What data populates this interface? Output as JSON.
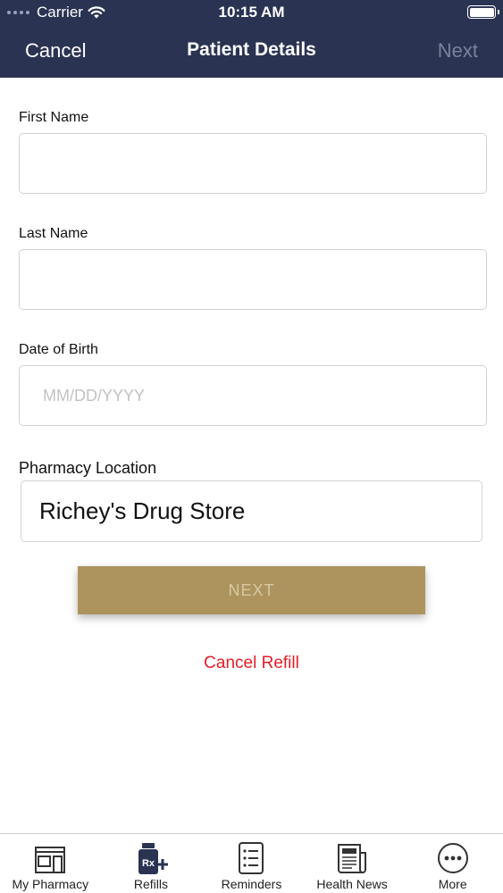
{
  "status_bar": {
    "carrier": "Carrier",
    "time": "10:15 AM"
  },
  "nav": {
    "cancel_label": "Cancel",
    "title": "Patient Details",
    "next_label": "Next"
  },
  "form": {
    "first_name": {
      "label": "First Name",
      "value": "",
      "placeholder": ""
    },
    "last_name": {
      "label": "Last Name",
      "value": "",
      "placeholder": ""
    },
    "dob": {
      "label": "Date of Birth",
      "value": "",
      "placeholder": "MM/DD/YYYY"
    },
    "pharmacy": {
      "label": "Pharmacy Location",
      "value": "Richey's Drug Store"
    }
  },
  "next_button_label": "NEXT",
  "cancel_refill_label": "Cancel Refill",
  "tabs": [
    {
      "label": "My Pharmacy",
      "icon": "storefront-icon"
    },
    {
      "label": "Refills",
      "icon": "rx-bottle-icon",
      "badge": "Rx"
    },
    {
      "label": "Reminders",
      "icon": "checklist-icon"
    },
    {
      "label": "Health News",
      "icon": "newspaper-icon"
    },
    {
      "label": "More",
      "icon": "more-dots-icon"
    }
  ],
  "colors": {
    "header": "#2a3352",
    "button": "#ad945e",
    "cancel_refill": "#e41e26"
  }
}
